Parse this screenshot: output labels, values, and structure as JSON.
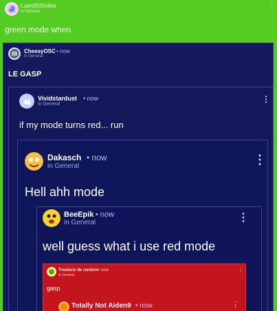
{
  "top": {
    "username": "Luan0925silva",
    "subtitle": "in General",
    "menu": "⋮"
  },
  "message": "green mode when",
  "posts": [
    {
      "name": "CheesyOSC",
      "meta": "• now",
      "channel": "in General",
      "text": "LE GASP"
    },
    {
      "name": "Vividstardust",
      "meta": "• now",
      "channel": "in General",
      "text": "if my mode turns red... run",
      "menu": "⋮"
    },
    {
      "name": "Dakasch",
      "meta": "• now",
      "channel": "in General",
      "text": "Hell ahh mode",
      "menu": "⋮"
    },
    {
      "name": "BeeEpik",
      "meta": "• now",
      "channel": "in General",
      "text": "well guess what i use red mode",
      "menu": "⋮"
    },
    {
      "name": "Treelexis de random",
      "meta": "• now",
      "channel": "in General",
      "text": "gasp",
      "menu": "⋮"
    },
    {
      "name": "Totally Not Aiden9",
      "meta": "• now",
      "menu": "⋮"
    }
  ],
  "colors": {
    "background": "#55cc22",
    "card": "#141a5c",
    "red_card": "#c4141c"
  }
}
